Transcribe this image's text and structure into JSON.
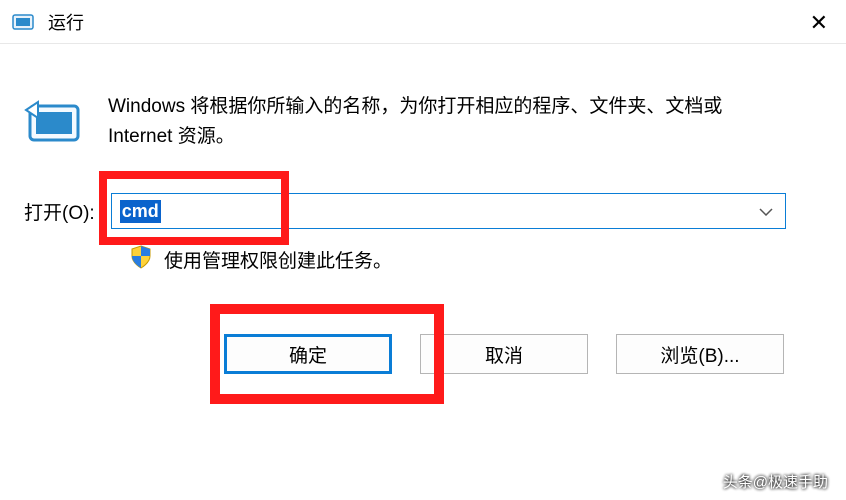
{
  "titlebar": {
    "title": "运行",
    "close": "✕"
  },
  "description": "Windows 将根据你所输入的名称，为你打开相应的程序、文件夹、文档或 Internet 资源。",
  "open_label": "打开(O):",
  "input_value": "cmd",
  "admin_note": "使用管理权限创建此任务。",
  "buttons": {
    "ok": "确定",
    "cancel": "取消",
    "browse": "浏览(B)..."
  },
  "watermark": "头条@极速手助",
  "icons": {
    "title": "run-small-icon",
    "run": "run-large-icon",
    "shield": "uac-shield-icon",
    "dropdown": "chevron-down-icon"
  }
}
